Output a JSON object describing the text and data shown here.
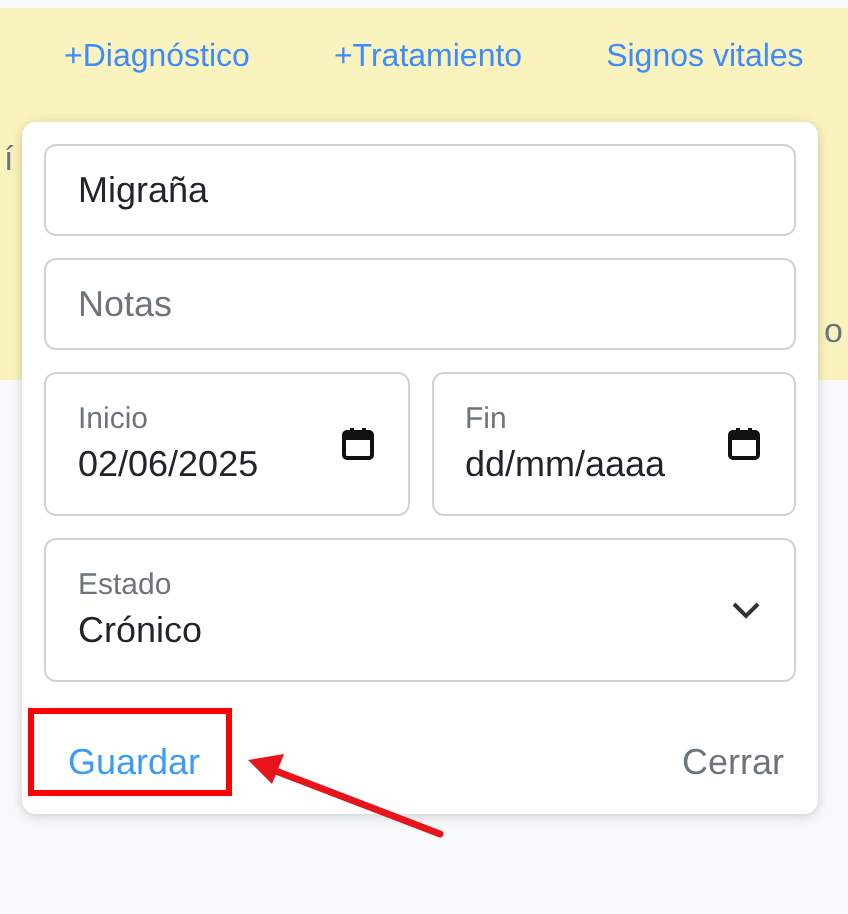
{
  "toolbar": {
    "links": [
      {
        "label": "+Diagnóstico"
      },
      {
        "label": "+Tratamiento"
      },
      {
        "label": "Signos vitales"
      }
    ]
  },
  "background_fragments": [
    "í",
    "o"
  ],
  "popup": {
    "fields": [
      {
        "kind": "text",
        "value": "Migraña"
      },
      {
        "kind": "text",
        "placeholder": "Notas"
      },
      {
        "kind": "date",
        "label": "Inicio",
        "value": "02/06/2025"
      },
      {
        "kind": "date",
        "label": "Fin",
        "placeholder": "dd/mm/aaaa"
      },
      {
        "kind": "select",
        "label": "Estado",
        "value": "Crónico"
      }
    ],
    "buttons": [
      {
        "label": "Guardar",
        "kind": "primary"
      },
      {
        "label": "Cerrar",
        "kind": "secondary"
      }
    ]
  },
  "annotations": [
    {
      "kind": "highlight"
    },
    {
      "kind": "arrow"
    }
  ]
}
